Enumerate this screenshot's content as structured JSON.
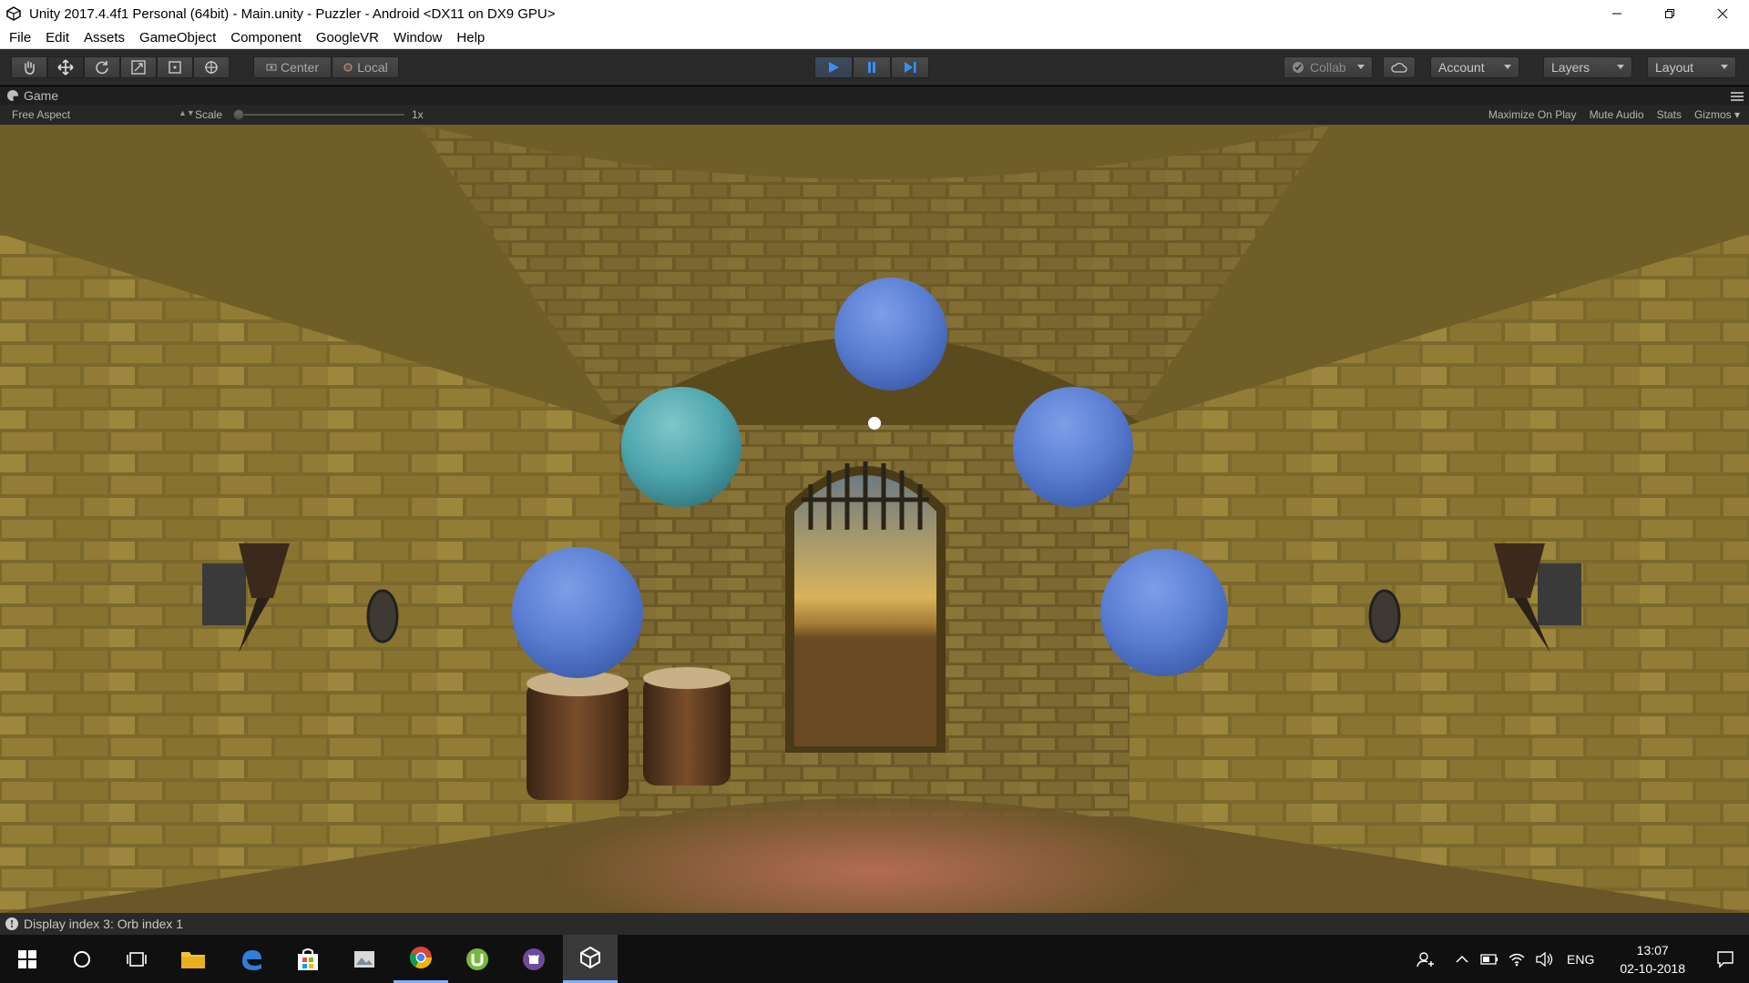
{
  "window": {
    "title": "Unity 2017.4.4f1 Personal (64bit) - Main.unity - Puzzler - Android <DX11 on DX9 GPU>",
    "controls": [
      "minimize",
      "restore",
      "close"
    ]
  },
  "menu": {
    "items": [
      "File",
      "Edit",
      "Assets",
      "GameObject",
      "Component",
      "GoogleVR",
      "Window",
      "Help"
    ]
  },
  "toolbar": {
    "transform_tools": [
      "hand-icon",
      "move-icon",
      "rotate-icon",
      "scale-icon",
      "rect-icon",
      "transform-icon"
    ],
    "pivot_center": "Center",
    "pivot_local": "Local",
    "playback": [
      "play-icon",
      "pause-icon",
      "step-icon"
    ],
    "collab": "Collab",
    "account": "Account",
    "layers": "Layers",
    "layout": "Layout"
  },
  "game_panel": {
    "tab_label": "Game",
    "aspect": "Free Aspect",
    "scale_label": "Scale",
    "scale_value": "1x",
    "options": [
      "Maximize On Play",
      "Mute Audio",
      "Stats",
      "Gizmos"
    ]
  },
  "scene": {
    "orbs": [
      {
        "name": "orb-top",
        "color": "#5b7fd4"
      },
      {
        "name": "orb-left",
        "color": "#4fa9b3",
        "highlighted": true
      },
      {
        "name": "orb-right",
        "color": "#5b7fd4"
      },
      {
        "name": "orb-bottom-left",
        "color": "#5b7fd4"
      },
      {
        "name": "orb-bottom-right",
        "color": "#5b7fd4"
      }
    ],
    "reticle": "white-dot",
    "wall_color": "#8a7430",
    "ceiling_color": "#7d6a2c"
  },
  "status": {
    "message": "Display index 3: Orb index 1"
  },
  "taskbar": {
    "apps": [
      "windows-start-icon",
      "cortana-icon",
      "task-view-icon",
      "file-explorer-icon",
      "edge-icon",
      "store-icon",
      "photos-icon",
      "chrome-icon",
      "utorrent-icon",
      "github-icon",
      "unity-icon"
    ],
    "active_app": "unity-icon",
    "language": "ENG",
    "time": "13:07",
    "date": "02-10-2018"
  }
}
